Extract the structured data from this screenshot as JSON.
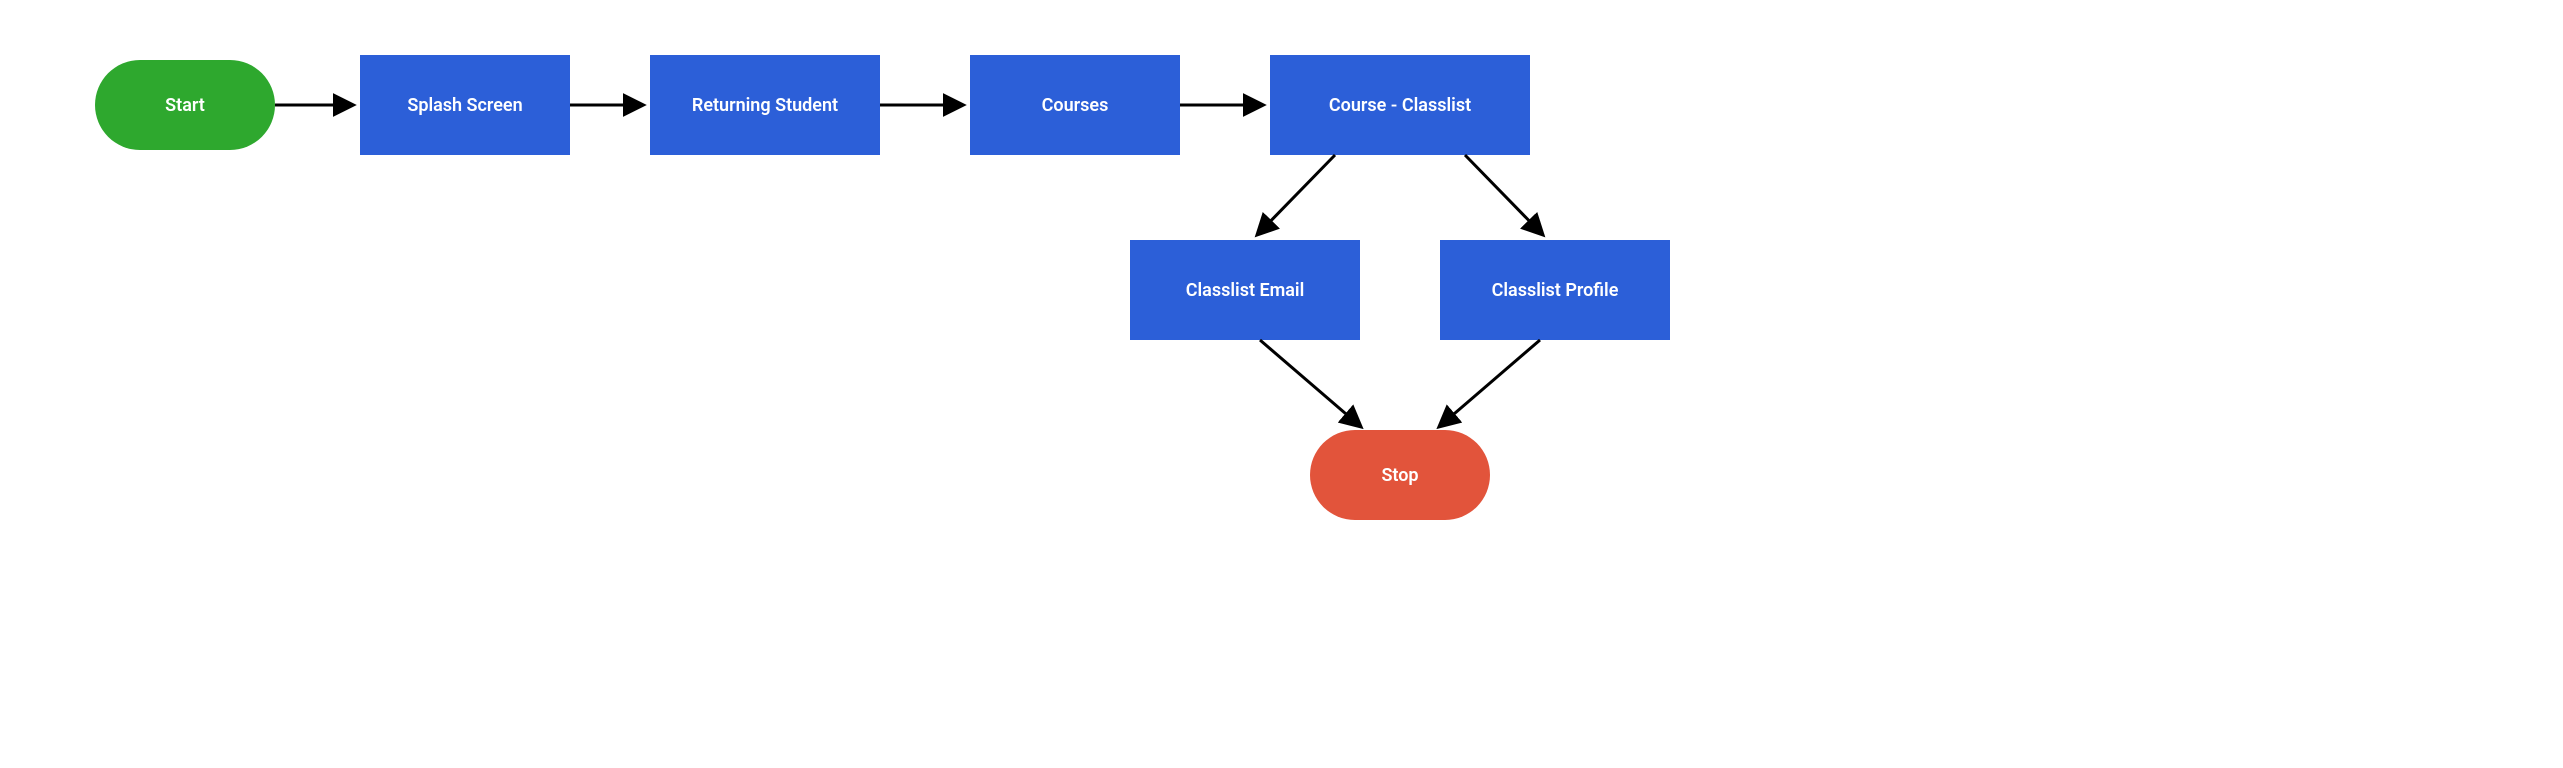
{
  "diagram": {
    "colors": {
      "start": "#2EA82E",
      "process": "#2C5FD8",
      "stop": "#E2543B",
      "arrow": "#000000",
      "text": "#ffffff"
    },
    "nodes": {
      "start": {
        "label": "Start"
      },
      "splashScreen": {
        "label": "Splash Screen"
      },
      "returningStudent": {
        "label": "Returning Student"
      },
      "courses": {
        "label": "Courses"
      },
      "courseClasslist": {
        "label": "Course - Classlist"
      },
      "classlistEmail": {
        "label": "Classlist Email"
      },
      "classlistProfile": {
        "label": "Classlist Profile"
      },
      "stop": {
        "label": "Stop"
      }
    },
    "edges": [
      [
        "start",
        "splashScreen"
      ],
      [
        "splashScreen",
        "returningStudent"
      ],
      [
        "returningStudent",
        "courses"
      ],
      [
        "courses",
        "courseClasslist"
      ],
      [
        "courseClasslist",
        "classlistEmail"
      ],
      [
        "courseClasslist",
        "classlistProfile"
      ],
      [
        "classlistEmail",
        "stop"
      ],
      [
        "classlistProfile",
        "stop"
      ]
    ]
  }
}
